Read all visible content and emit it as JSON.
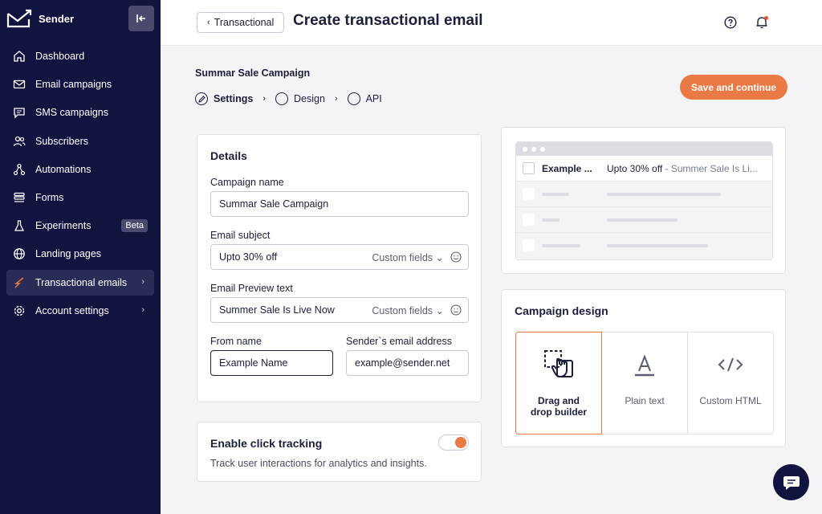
{
  "sidebar": {
    "brand": "Sender",
    "items": [
      {
        "label": "Dashboard",
        "icon": "home-icon"
      },
      {
        "label": "Email campaigns",
        "icon": "mail-icon"
      },
      {
        "label": "SMS campaigns",
        "icon": "chat-icon"
      },
      {
        "label": "Subscribers",
        "icon": "users-icon"
      },
      {
        "label": "Automations",
        "icon": "flow-icon"
      },
      {
        "label": "Forms",
        "icon": "forms-icon"
      },
      {
        "label": "Experiments",
        "icon": "flask-icon",
        "badge": "Beta"
      },
      {
        "label": "Landing pages",
        "icon": "globe-icon"
      },
      {
        "label": "Transactional emails",
        "icon": "bolt-icon",
        "active": true
      },
      {
        "label": "Account settings",
        "icon": "gear-icon"
      }
    ]
  },
  "header": {
    "back_label": "Transactional",
    "title": "Create transactional email"
  },
  "campaign_name": "Summar Sale Campaign",
  "steps": [
    {
      "label": "Settings",
      "current": true
    },
    {
      "label": "Design"
    },
    {
      "label": "API"
    }
  ],
  "save_label": "Save and continue",
  "details": {
    "title": "Details",
    "campaign_name_label": "Campaign name",
    "campaign_name_value": "Summar Sale Campaign",
    "subject_label": "Email subject",
    "subject_value": "Upto 30% off",
    "custom_fields": "Custom fields",
    "preview_label": "Email Preview text",
    "preview_value": "Summer Sale Is Live Now",
    "from_name_label": "From name",
    "from_name_value": "Example Name",
    "sender_email_label": "Sender`s email address",
    "sender_email_value": "example@sender.net"
  },
  "tracking": {
    "title": "Enable click tracking",
    "description": "Track user interactions for analytics and insights.",
    "enabled": true
  },
  "inbox_preview": {
    "from": "Example ...",
    "subject": "Upto 30% off",
    "preheader": " - Summer Sale Is Li..."
  },
  "design": {
    "title": "Campaign design",
    "options": [
      {
        "label": "Drag and drop builder",
        "icon": "drag-drop-icon",
        "selected": true
      },
      {
        "label": "Plain text",
        "icon": "text-icon"
      },
      {
        "label": "Custom HTML",
        "icon": "code-icon"
      }
    ]
  },
  "colors": {
    "sidebar_bg": "#131340",
    "accent": "#ea7a45"
  }
}
